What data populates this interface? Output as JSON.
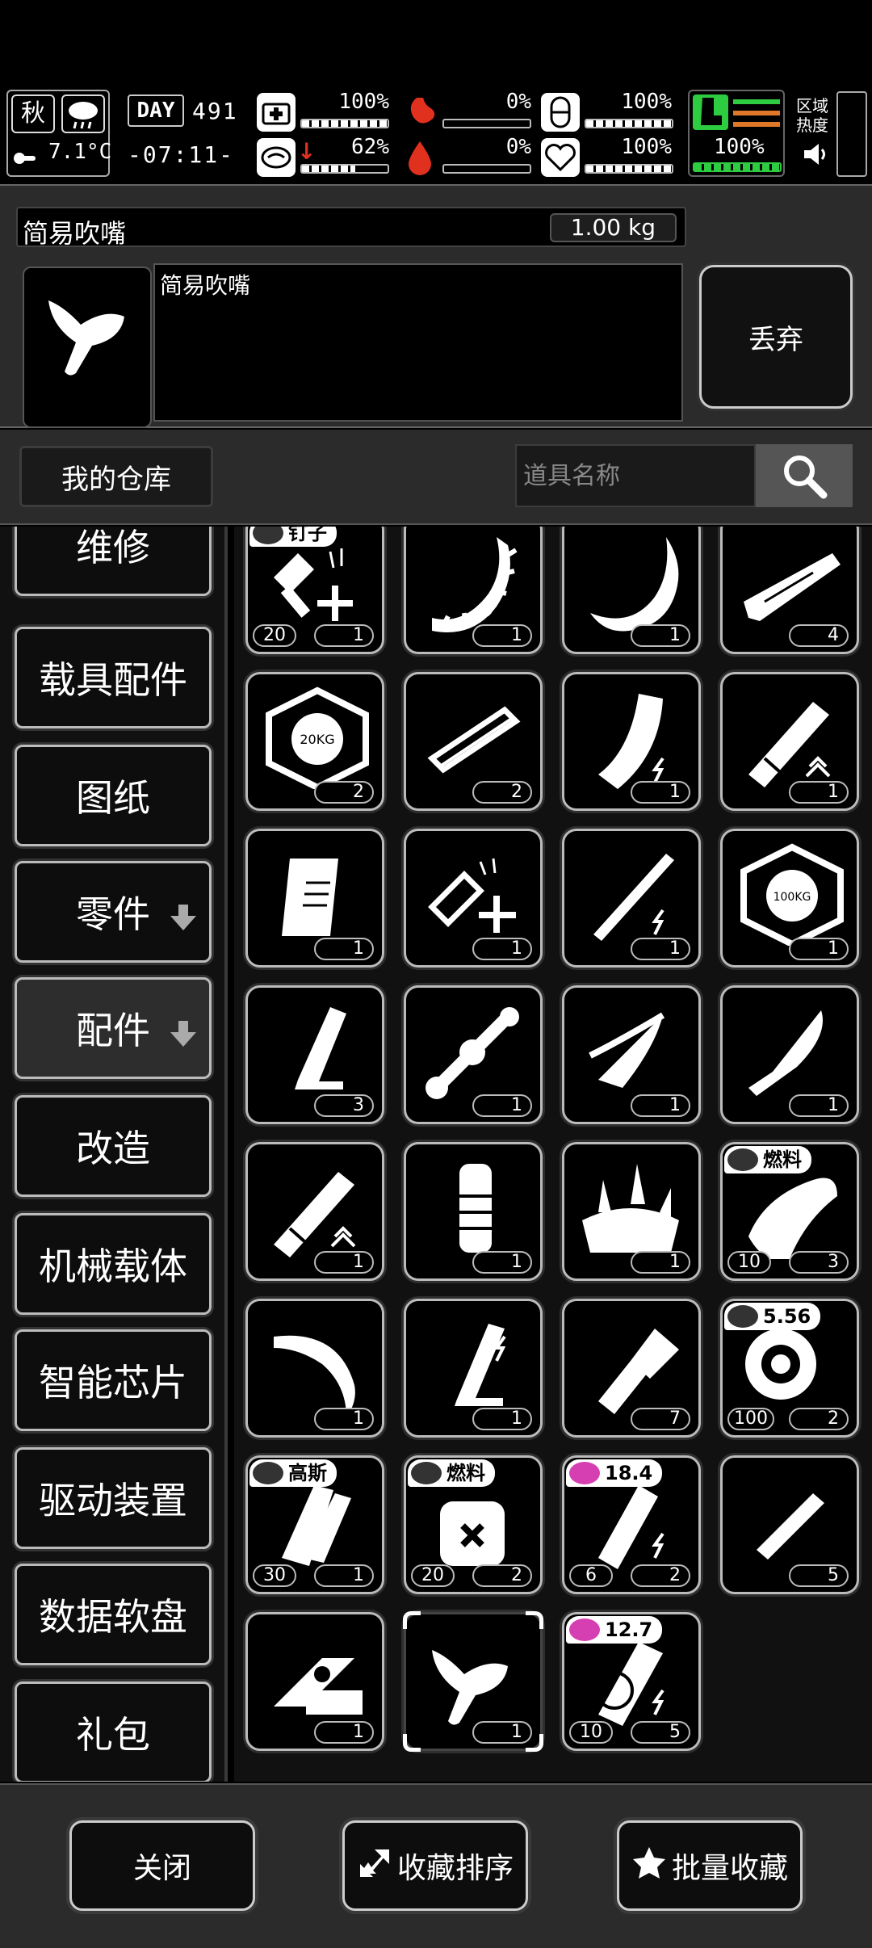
{
  "status": {
    "season": "秋",
    "temperature": "7.1°C",
    "day_label": "DAY",
    "day_number": "491",
    "clock": "-07:11-",
    "health_pct": "100%",
    "stamina_pct": "62%",
    "hunger_pct": "0%",
    "bleed_pct": "0%",
    "capsule_pct": "100%",
    "heart_pct": "100%",
    "boot_pct": "100%",
    "zone_heat_label": "区域热度"
  },
  "item": {
    "name": "简易吹嘴",
    "weight": "1.00 kg",
    "description": "简易吹嘴",
    "discard_label": "丢弃"
  },
  "warehouse": {
    "tab_label": "我的仓库",
    "search_placeholder": "道具名称"
  },
  "sidebar": {
    "items": [
      {
        "label": "维修"
      },
      {
        "label": "载具配件"
      },
      {
        "label": "图纸"
      },
      {
        "label": "零件"
      },
      {
        "label": "配件"
      },
      {
        "label": "改造"
      },
      {
        "label": "机械载体"
      },
      {
        "label": "智能芯片"
      },
      {
        "label": "驱动装置"
      },
      {
        "label": "数据软盘"
      },
      {
        "label": "礼包"
      }
    ]
  },
  "grid": {
    "items": [
      {
        "icon": "nail-kit-icon",
        "qty": "1",
        "sub": "20",
        "tag": "钉子"
      },
      {
        "icon": "spiked-arc-icon",
        "qty": "1"
      },
      {
        "icon": "curved-blade-icon",
        "qty": "1"
      },
      {
        "icon": "wood-plank-icon",
        "qty": "4"
      },
      {
        "icon": "weight-plate-20kg-icon",
        "qty": "2"
      },
      {
        "icon": "rail-mount-icon",
        "qty": "2"
      },
      {
        "icon": "curved-magazine-icon",
        "qty": "1"
      },
      {
        "icon": "suppressor-icon",
        "qty": "1"
      },
      {
        "icon": "grip-icon",
        "qty": "1"
      },
      {
        "icon": "repair-kit-icon",
        "qty": "1"
      },
      {
        "icon": "rod-icon",
        "qty": "1"
      },
      {
        "icon": "weight-plate-100kg-icon",
        "qty": "1"
      },
      {
        "icon": "pistol-magazine-icon",
        "qty": "3"
      },
      {
        "icon": "scope-icon",
        "qty": "1"
      },
      {
        "icon": "claw-blades-icon",
        "qty": "1"
      },
      {
        "icon": "knife-blade-icon",
        "qty": "1"
      },
      {
        "icon": "suppressor-icon",
        "qty": "1"
      },
      {
        "icon": "foregrip-icon",
        "qty": "1"
      },
      {
        "icon": "spike-plate-icon",
        "qty": "1"
      },
      {
        "icon": "fuel-tank-icon",
        "qty": "3",
        "sub": "10",
        "tag": "燃料"
      },
      {
        "icon": "hook-blade-icon",
        "qty": "1"
      },
      {
        "icon": "magazine-icon",
        "qty": "1"
      },
      {
        "icon": "flashlight-icon",
        "qty": "7"
      },
      {
        "icon": "drum-mag-icon",
        "qty": "2",
        "sub": "100",
        "tag": "5.56"
      },
      {
        "icon": "stacked-magazine-icon",
        "qty": "1",
        "sub": "30",
        "tag": "高斯"
      },
      {
        "icon": "fuel-canister-icon",
        "qty": "2",
        "sub": "20",
        "tag": "燃料"
      },
      {
        "icon": "energy-magazine-icon",
        "qty": "2",
        "sub": "6",
        "tag": "18.4"
      },
      {
        "icon": "small-rod-icon",
        "qty": "5"
      },
      {
        "icon": "red-dot-sight-icon",
        "qty": "1"
      },
      {
        "icon": "mouthpiece-icon",
        "qty": "1",
        "selected": true
      },
      {
        "icon": "revolver-cylinder-icon",
        "qty": "5",
        "sub": "10",
        "tag": "12.7"
      }
    ]
  },
  "bottom": {
    "close_label": "关闭",
    "sort_label": "收藏排序",
    "batch_label": "批量收藏"
  },
  "colors": {
    "panel": "#2b2b2b",
    "border": "#bbbbbb",
    "accent_green": "#2ecc40",
    "accent_red": "#e0301e",
    "accent_pink": "#d63fb2",
    "accent_orange": "#e0782a"
  }
}
